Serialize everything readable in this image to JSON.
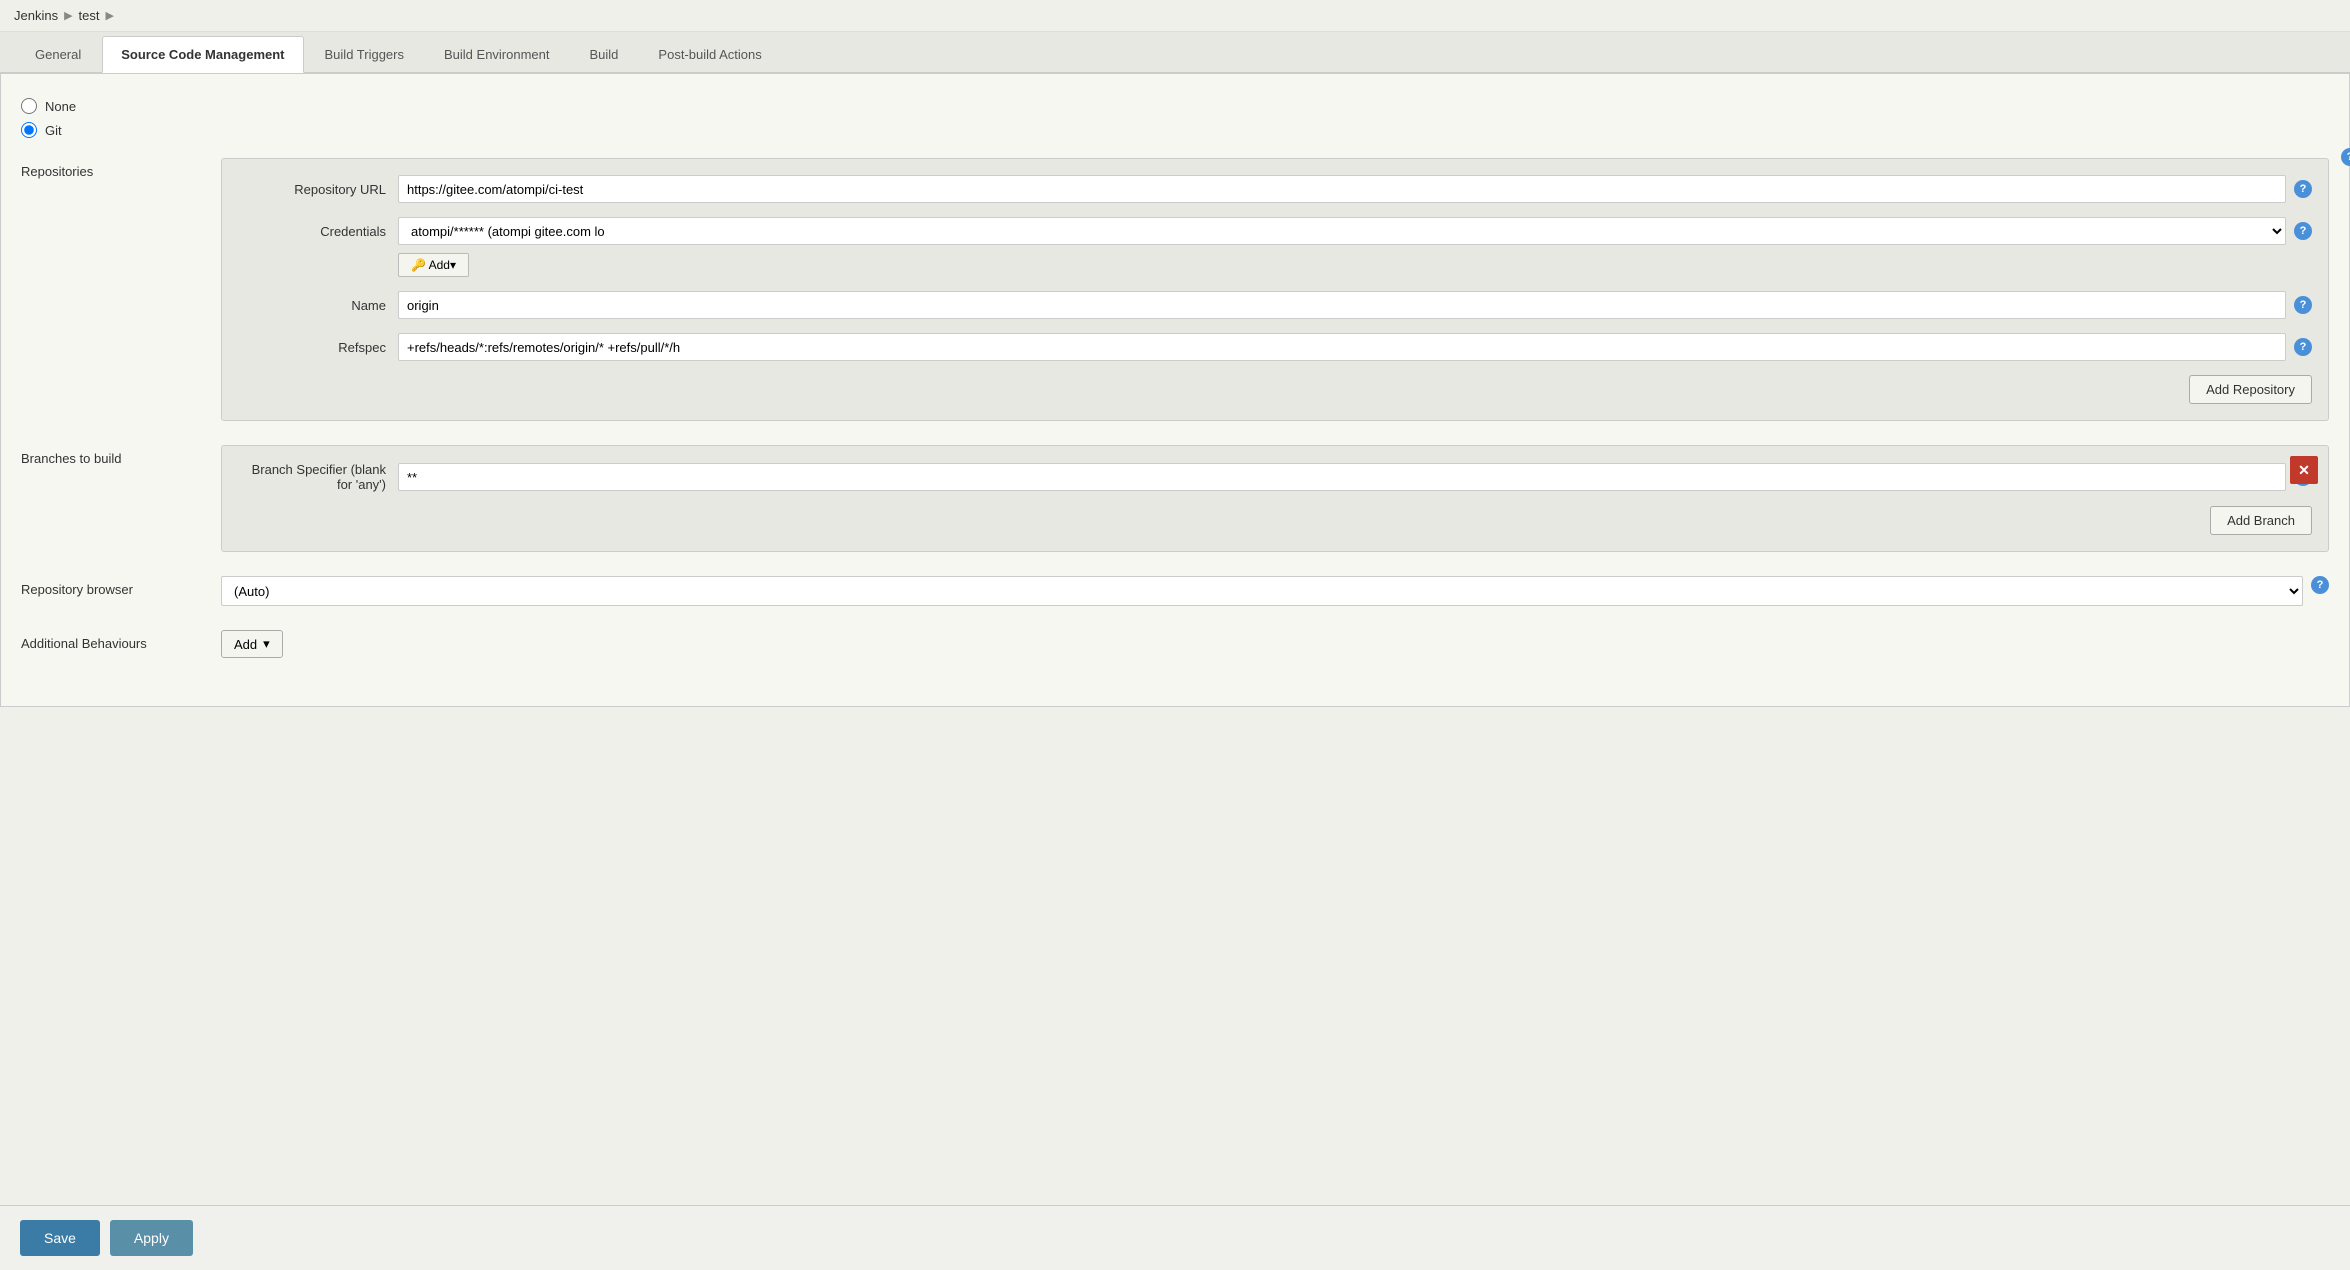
{
  "breadcrumb": {
    "items": [
      "Jenkins",
      "test"
    ],
    "separators": [
      "▶",
      "▶"
    ]
  },
  "tabs": [
    {
      "id": "general",
      "label": "General",
      "active": false
    },
    {
      "id": "scm",
      "label": "Source Code Management",
      "active": true
    },
    {
      "id": "build-triggers",
      "label": "Build Triggers",
      "active": false
    },
    {
      "id": "build-env",
      "label": "Build Environment",
      "active": false
    },
    {
      "id": "build",
      "label": "Build",
      "active": false
    },
    {
      "id": "post-build",
      "label": "Post-build Actions",
      "active": false
    }
  ],
  "scm": {
    "none_label": "None",
    "git_label": "Git",
    "repositories_label": "Repositories",
    "repo_url_label": "Repository URL",
    "repo_url_value": "https://gitee.com/atompi/ci-test",
    "credentials_label": "Credentials",
    "credentials_value": "atompi/****** (atompi gitee.com lo",
    "add_button_label": "🔑 Add▾",
    "name_label": "Name",
    "name_value": "origin",
    "refspec_label": "Refspec",
    "refspec_value": "+refs/heads/*:refs/remotes/origin/* +refs/pull/*/h",
    "add_repository_label": "Add Repository",
    "branches_label": "Branches to build",
    "branch_specifier_label": "Branch Specifier (blank for 'any')",
    "branch_specifier_value": "**",
    "add_branch_label": "Add Branch",
    "repo_browser_label": "Repository browser",
    "repo_browser_value": "(Auto)",
    "additional_behaviours_label": "Additional Behaviours",
    "add_label": "Add",
    "help_icon": "?"
  },
  "bottom_bar": {
    "save_label": "Save",
    "apply_label": "Apply"
  }
}
